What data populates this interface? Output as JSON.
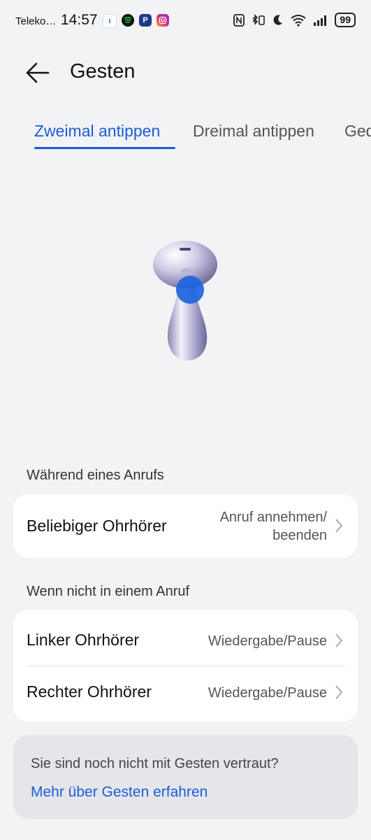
{
  "status_bar": {
    "carrier": "Teleko…",
    "time": "14:57",
    "battery": "99"
  },
  "header": {
    "title": "Gesten"
  },
  "tabs": [
    {
      "label": "Zweimal antippen"
    },
    {
      "label": "Dreimal antippen"
    },
    {
      "label": "Gedrückt halten"
    }
  ],
  "sections": {
    "during_call": {
      "label": "Während eines Anrufs",
      "rows": [
        {
          "title": "Beliebiger Ohrhörer",
          "value_line1": "Anruf annehmen/",
          "value_line2": "beenden"
        }
      ]
    },
    "not_in_call": {
      "label": "Wenn nicht in einem Anruf",
      "rows": [
        {
          "title": "Linker Ohrhörer",
          "value": "Wiedergabe/Pause"
        },
        {
          "title": "Rechter Ohrhörer",
          "value": "Wiedergabe/Pause"
        }
      ]
    }
  },
  "info": {
    "text": "Sie sind noch nicht mit Gesten vertraut?",
    "link": "Mehr über Gesten erfahren"
  },
  "colors": {
    "accent": "#1e5bd6",
    "background": "#f1f3f5"
  }
}
